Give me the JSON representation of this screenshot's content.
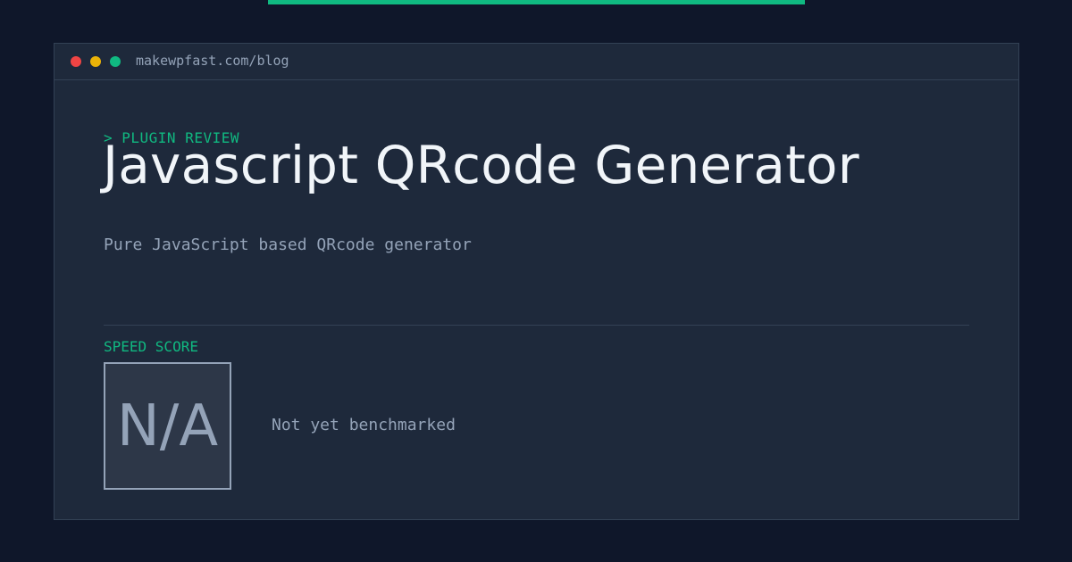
{
  "colors": {
    "background": "#0f172a",
    "panel": "#1e293b",
    "accent": "#10b981",
    "title_text": "#f1f5f9",
    "muted_text": "#94a3b8",
    "border": "#334155",
    "window_close": "#ef4444",
    "window_minimize": "#eab308",
    "window_maximize": "#10b981"
  },
  "window": {
    "url": "makewpfast.com/blog",
    "controls": [
      "close-dot",
      "minimize-dot",
      "maximize-dot"
    ]
  },
  "article": {
    "category": "> PLUGIN REVIEW",
    "title": "Javascript QRcode Generator",
    "description": "Pure JavaScript based QRcode generator"
  },
  "speed": {
    "label": "SPEED SCORE",
    "score": "N/A",
    "note": "Not yet benchmarked"
  }
}
